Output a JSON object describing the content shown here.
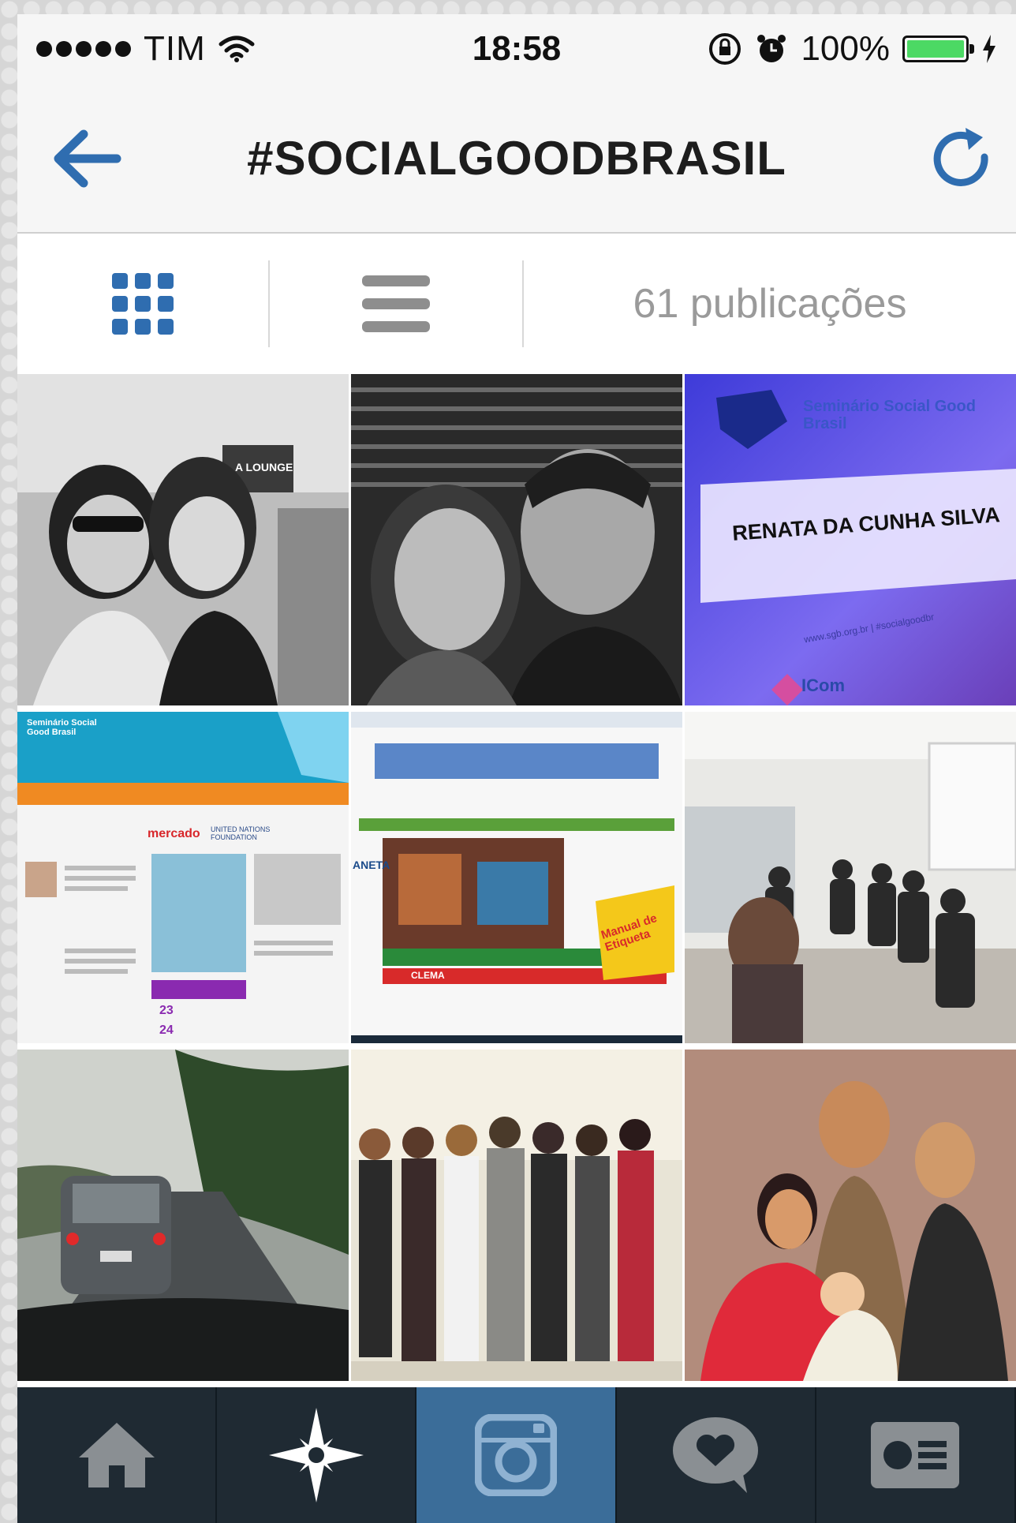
{
  "status_bar": {
    "carrier": "TIM",
    "time": "18:58",
    "battery": "100%",
    "battery_level": 1.0
  },
  "nav": {
    "title": "#SOCIALGOODBRASIL",
    "back_icon": "arrow-left-icon",
    "refresh_icon": "refresh-icon"
  },
  "toolbar": {
    "grid_icon": "grid-view-icon",
    "list_icon": "list-view-icon",
    "count_label": "61 publicações"
  },
  "grid": {
    "posts": [
      {
        "label": "A LOUNGE"
      },
      {
        "label": ""
      },
      {
        "title": "Seminário Social Good Brasil",
        "name": "RENATA DA CUNHA SILVA",
        "site": "www.sgb.org.br | #socialgoodbr",
        "logo": "ICom"
      },
      {
        "header": "Seminário Social Good Brasil",
        "brand": "mercado",
        "org": "UNITED NATIONS FOUNDATION",
        "dates": [
          "23",
          "24"
        ]
      },
      {
        "side": "ANETA",
        "label": "CLEMA",
        "sticker": "Manual de Etiqueta"
      },
      {
        "label": ""
      },
      {
        "label": ""
      },
      {
        "label": ""
      },
      {
        "label": ""
      }
    ]
  },
  "tab_bar": {
    "items": [
      "home-icon",
      "explore-icon",
      "camera-icon",
      "activity-icon",
      "profile-icon"
    ],
    "active_index": 2,
    "colors": {
      "bar": "#1f2a33",
      "active": "#3b6d99"
    }
  }
}
